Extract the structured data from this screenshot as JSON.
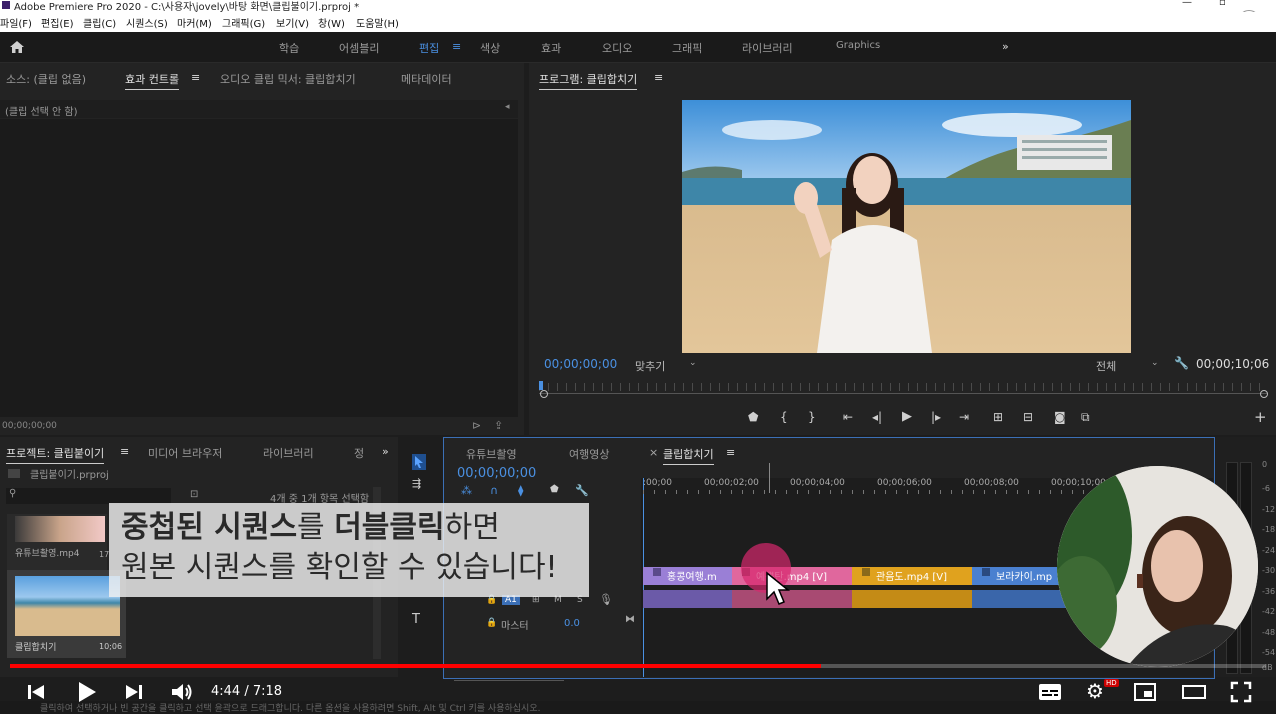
{
  "window": {
    "title": "Adobe Premiere Pro 2020 - C:\\사용자\\jovely\\바탕 화면\\클립불이기.prproj *"
  },
  "menu": [
    "파일(F)",
    "편집(E)",
    "클립(C)",
    "시퀀스(S)",
    "마커(M)",
    "그래픽(G)",
    "보기(V)",
    "창(W)",
    "도움말(H)"
  ],
  "workspaces": [
    "학습",
    "어셈블리",
    "편집",
    "색상",
    "효과",
    "오디오",
    "그래픽",
    "라이브러리",
    "Graphics"
  ],
  "source_panel": {
    "tabs": [
      "소스: (클립 없음)",
      "효과 컨트롤",
      "오디오 클립 믹서: 클립합치기",
      "메타데이터"
    ],
    "empty_text": "(클립 선택 안 함)",
    "timecode": "00;00;00;00"
  },
  "program_monitor": {
    "tab": "프로그램: 클립합치기",
    "timecode_left": "00;00;00;00",
    "fit_label": "맞추기",
    "quality_label": "전체",
    "timecode_right": "00;00;10;06"
  },
  "project_panel": {
    "tabs": [
      "프로젝트: 클립붙이기",
      "미디어 브라우저",
      "라이브러리",
      "정"
    ],
    "project_file": "클립붙이기.prproj",
    "status": "4개 중 1개 항목 선택함",
    "items": [
      {
        "name": "유튜브촬영.mp4",
        "duration": "17"
      },
      {
        "name": "클립합치기",
        "duration": "10;06"
      }
    ]
  },
  "timeline": {
    "tabs": [
      "유튜브촬영",
      "여행영상",
      "클립합치기"
    ],
    "timecode": "00;00;00;00",
    "ruler": [
      ":00;00",
      "00;00;02;00",
      "00;00;04;00",
      "00;00;06;00",
      "00;00;08;00",
      "00;00;10;00"
    ],
    "clips_video": [
      "홍콩여행.m",
      "예쁜탄.mp4 [V]",
      "관음도.mp4 [V]",
      "보라카이.mp"
    ],
    "track_a1": "A1",
    "track_controls": [
      "M",
      "S"
    ],
    "master_label": "마스터",
    "master_value": "0.0"
  },
  "meter_scale": [
    "0",
    "-6",
    "-12",
    "-18",
    "-24",
    "-30",
    "-36",
    "-42",
    "-48",
    "-54",
    "dB"
  ],
  "status_bar": "클릭하여 선택하거나 빈 공간을 클릭하고 선택 윤곽으로 드래그합니다. 다른 옵션을 사용하려면 Shift, Alt 및 Ctrl 키를 사용하십시오.",
  "caption": {
    "line1_bold1": "중첩된 시퀀스",
    "line1_plain1": "를 ",
    "line1_bold2": "더블클릭",
    "line1_plain2": "하면",
    "line2": "원본 시퀀스를 확인할 수 있습니다!"
  },
  "player": {
    "time": "4:44 / 7:18",
    "progress": 0.646,
    "hd_badge": "HD"
  },
  "colors": {
    "accent_blue": "#4a90e2",
    "clip_purple": "#9a7fd6",
    "clip_pink": "#e0679d",
    "clip_orange": "#e0a21e",
    "clip_blue": "#4a80d0",
    "youtube_red": "#ff0000"
  }
}
